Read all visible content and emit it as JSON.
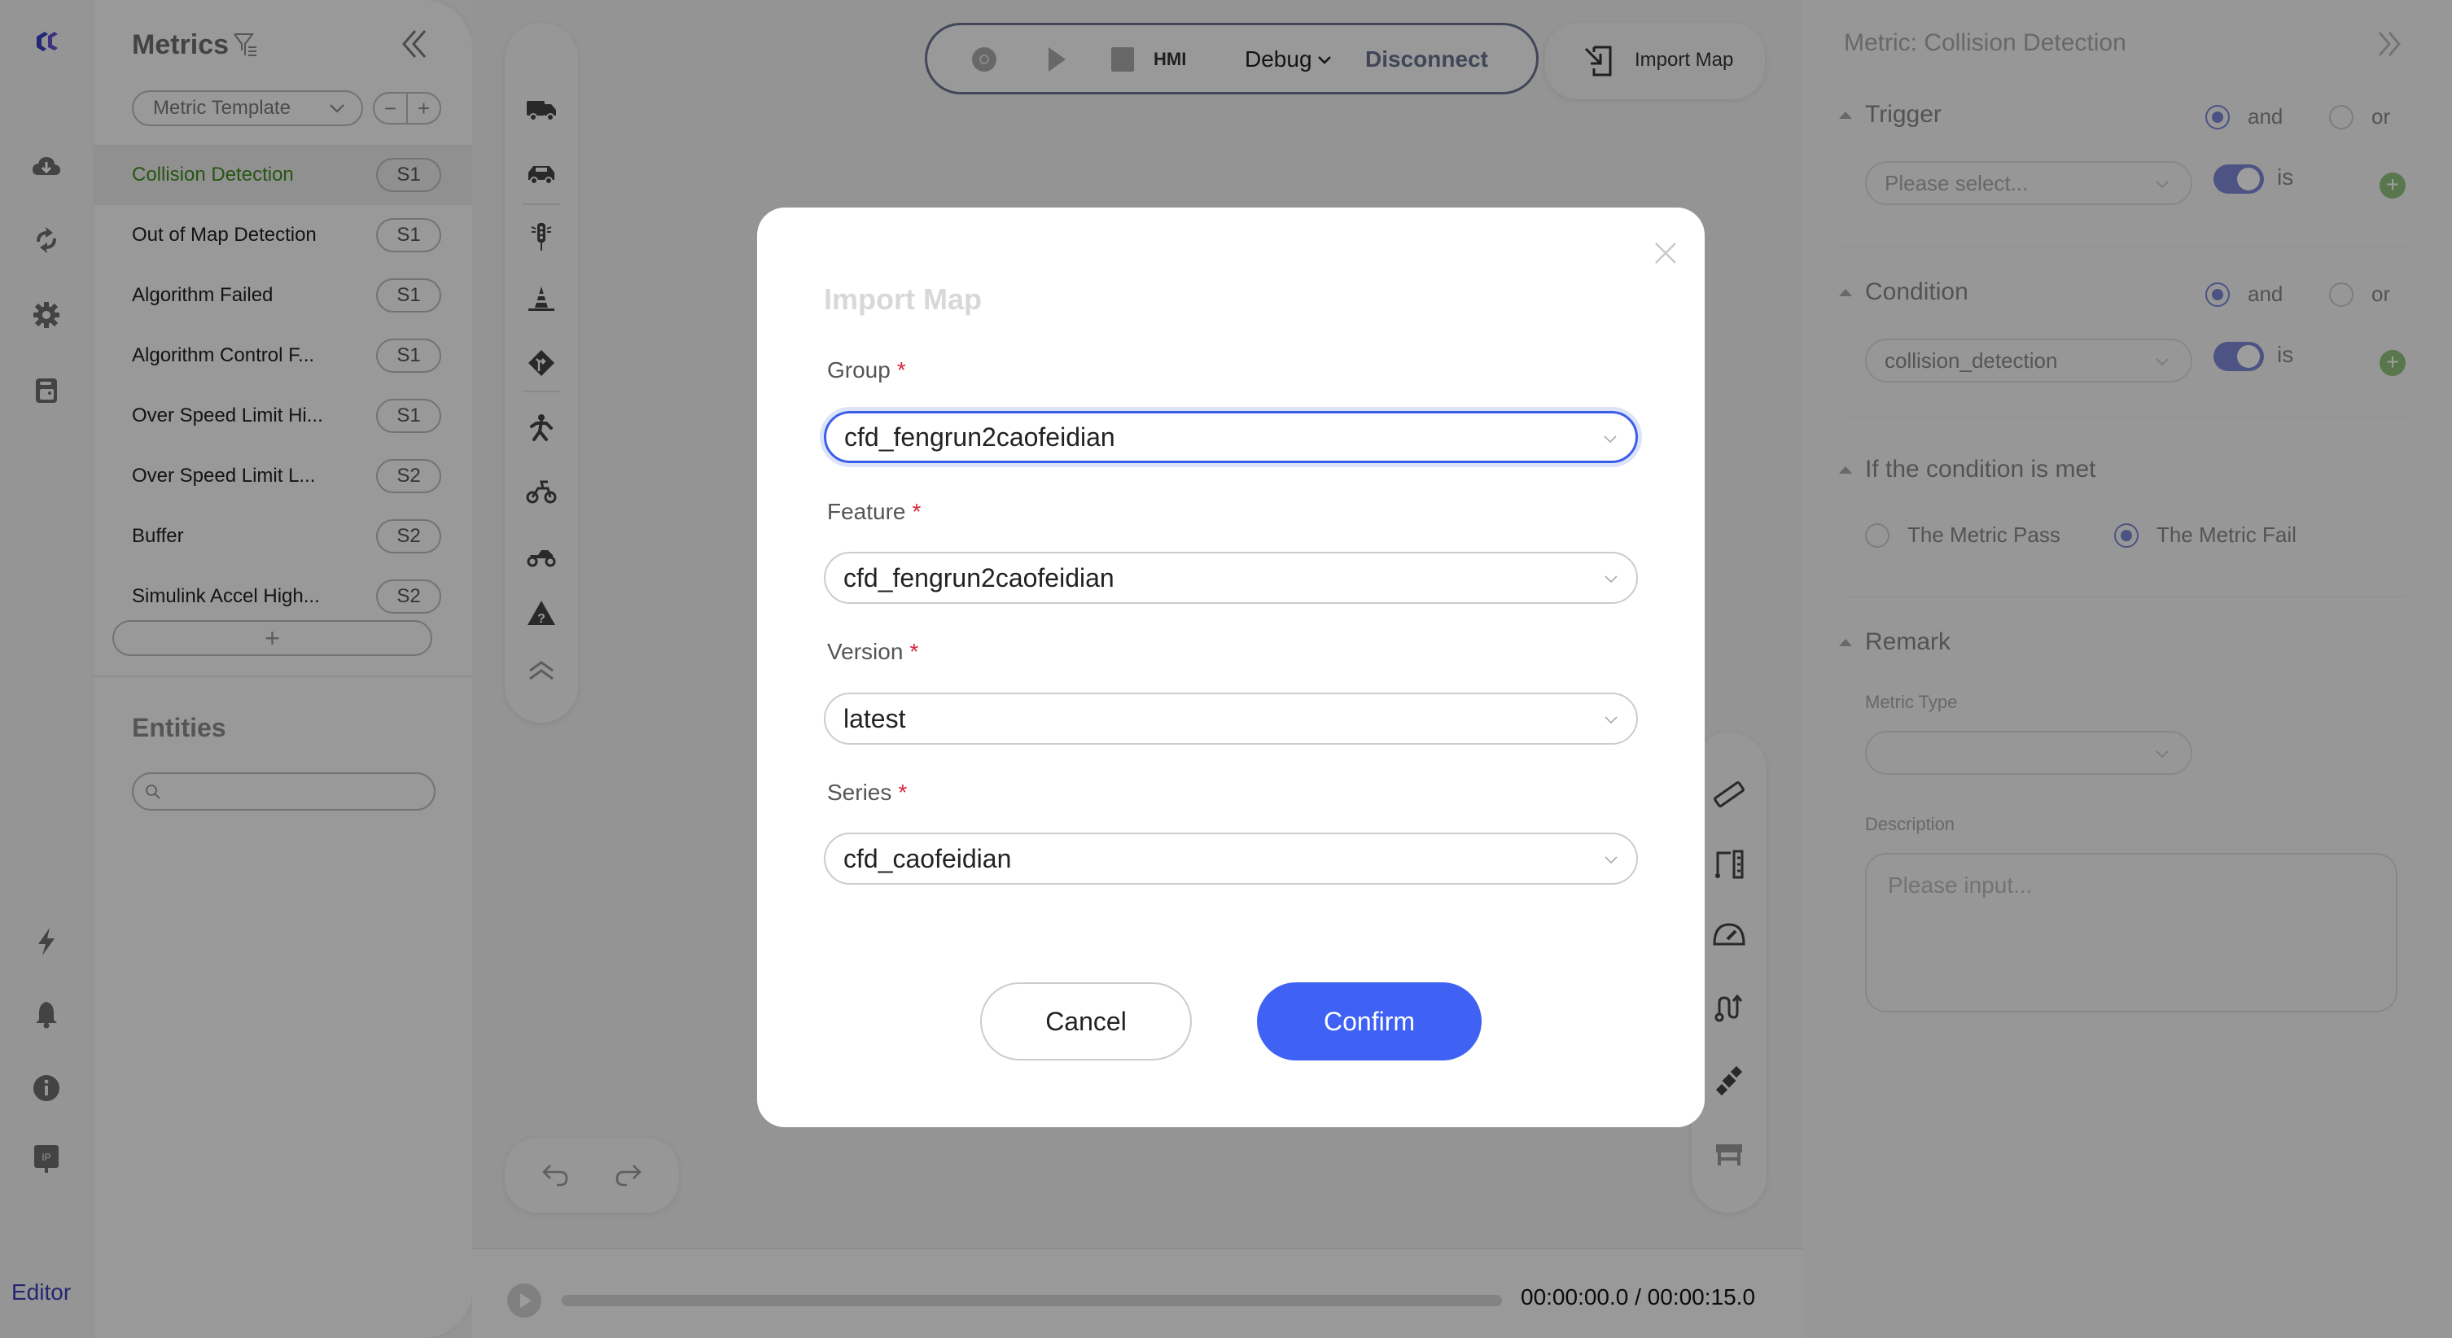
{
  "rail": {
    "items": [
      {
        "icon": "logo-icon"
      },
      {
        "icon": "cloud-download-icon"
      },
      {
        "icon": "sync-icon"
      },
      {
        "icon": "gear-icon"
      },
      {
        "icon": "save-icon"
      },
      {
        "icon": "lightning-icon"
      },
      {
        "icon": "bell-icon"
      },
      {
        "icon": "info-icon"
      },
      {
        "icon": "ip-icon"
      }
    ],
    "mode_label": "Editor"
  },
  "metrics": {
    "title": "Metrics",
    "template_select": "Metric Template",
    "minus": "−",
    "plus": "+",
    "items": [
      {
        "label": "Collision Detection",
        "badge": "S1",
        "active": true
      },
      {
        "label": "Out of Map Detection",
        "badge": "S1"
      },
      {
        "label": "Algorithm Failed",
        "badge": "S1"
      },
      {
        "label": "Algorithm Control F...",
        "badge": "S1"
      },
      {
        "label": "Over Speed Limit Hi...",
        "badge": "S1"
      },
      {
        "label": "Over Speed Limit L...",
        "badge": "S2"
      },
      {
        "label": "Buffer",
        "badge": "S2"
      },
      {
        "label": "Simulink Accel High...",
        "badge": "S2"
      }
    ],
    "add_label": "+"
  },
  "entities": {
    "title": "Entities",
    "search_placeholder": ""
  },
  "toolbar": {
    "hmi": "HMI",
    "debug": "Debug",
    "disconnect": "Disconnect",
    "import_map": "Import Map"
  },
  "left_tools": [
    "truck-icon",
    "car-icon",
    "traffic-light-icon",
    "cone-icon",
    "road-sign-icon",
    "pedestrian-icon",
    "bicycle-icon",
    "motorcycle-icon",
    "warning-icon",
    "expand-up-icon"
  ],
  "right_tools": [
    "ruler-icon",
    "measure-icon",
    "speedometer-icon",
    "route-icon",
    "satellite-icon",
    "bench-icon"
  ],
  "timeline": {
    "time": "00:00:00.0 / 00:00:15.0",
    "progress": 0
  },
  "right_panel": {
    "title": "Metric: Collision Detection",
    "trigger": {
      "label": "Trigger",
      "and": "and",
      "or": "or",
      "selected": "and",
      "select_placeholder": "Please select...",
      "is": "is"
    },
    "condition": {
      "label": "Condition",
      "and": "and",
      "or": "or",
      "selected": "and",
      "select_value": "collision_detection",
      "is": "is"
    },
    "result": {
      "label": "If the condition is met",
      "pass": "The Metric Pass",
      "fail": "The Metric Fail",
      "selected": "The Metric Fail"
    },
    "remark": {
      "label": "Remark",
      "metric_type_label": "Metric Type",
      "metric_type_value": "",
      "description_label": "Description",
      "description_placeholder": "Please input..."
    }
  },
  "modal": {
    "title": "Import Map",
    "fields": [
      {
        "label": "Group",
        "required": "*",
        "value": "cfd_fengrun2caofeidian",
        "focused": true
      },
      {
        "label": "Feature",
        "required": "*",
        "value": "cfd_fengrun2caofeidian"
      },
      {
        "label": "Version",
        "required": "*",
        "value": "latest"
      },
      {
        "label": "Series",
        "required": "*",
        "value": "cfd_caofeidian"
      }
    ],
    "cancel": "Cancel",
    "confirm": "Confirm",
    "colors": {
      "primary": "#3f62f5",
      "required": "#d7263d",
      "active_metric": "#3f8a1f"
    }
  }
}
